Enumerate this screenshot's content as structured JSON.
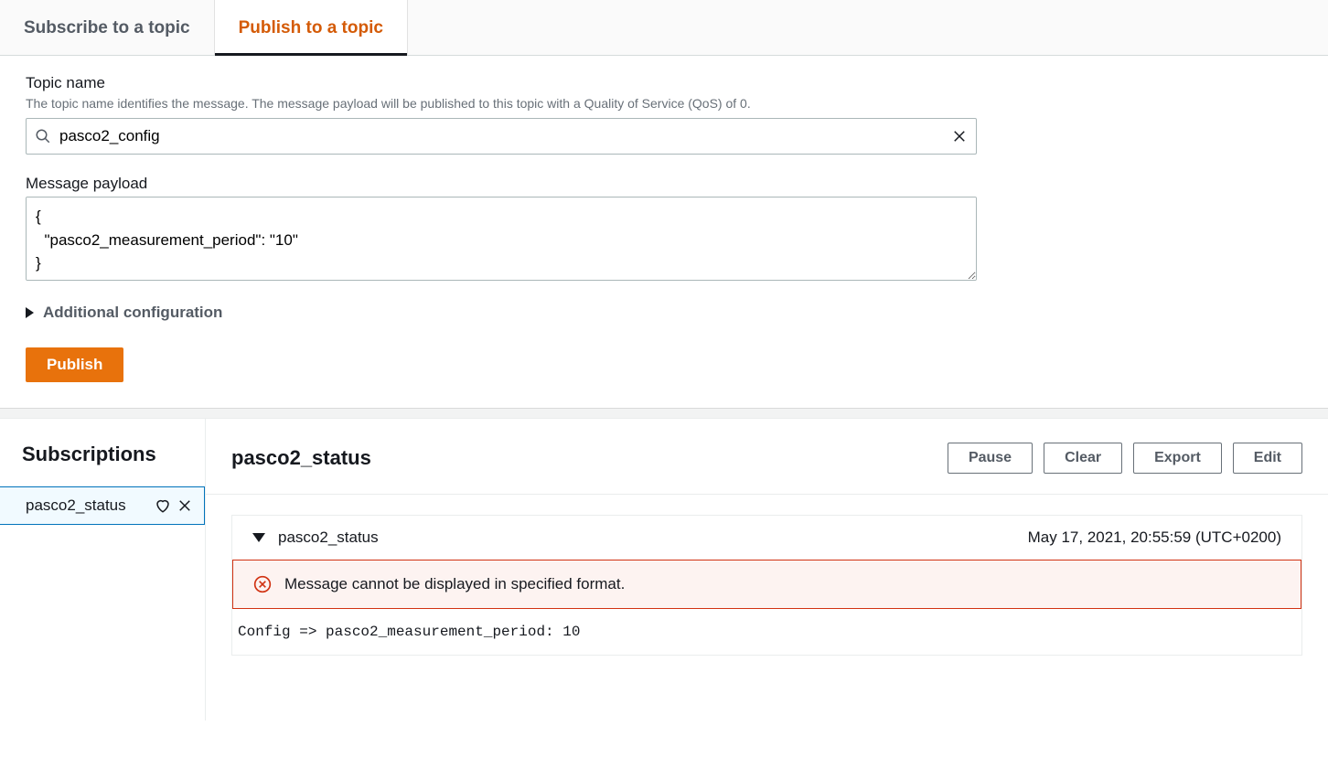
{
  "tabs": {
    "subscribe": "Subscribe to a topic",
    "publish": "Publish to a topic"
  },
  "form": {
    "topic_label": "Topic name",
    "topic_hint": "The topic name identifies the message. The message payload will be published to this topic with a Quality of Service (QoS) of 0.",
    "topic_value": "pasco2_config",
    "payload_label": "Message payload",
    "payload_value": "{\n  \"pasco2_measurement_period\": \"10\"\n}",
    "additional_config": "Additional configuration",
    "publish_btn": "Publish"
  },
  "subscriptions": {
    "title": "Subscriptions",
    "items": [
      "pasco2_status"
    ]
  },
  "detail": {
    "title": "pasco2_status",
    "buttons": {
      "pause": "Pause",
      "clear": "Clear",
      "export": "Export",
      "edit": "Edit"
    },
    "message": {
      "topic": "pasco2_status",
      "timestamp": "May 17, 2021, 20:55:59 (UTC+0200)",
      "error": "Message cannot be displayed in specified format.",
      "raw": "Config => pasco2_measurement_period: 10"
    }
  }
}
